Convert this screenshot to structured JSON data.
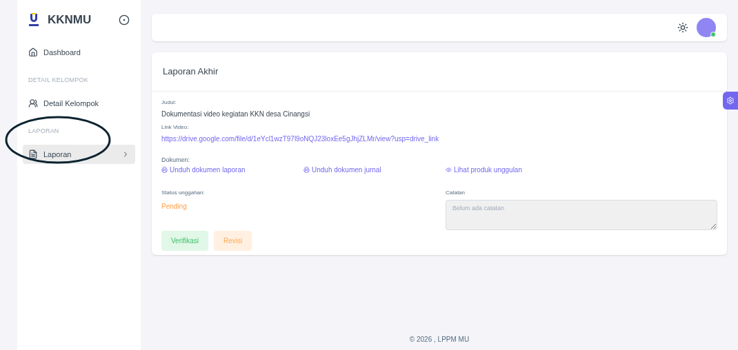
{
  "sidebar": {
    "brand": "KKNMU",
    "items": [
      {
        "kind": "link",
        "label": "Dashboard",
        "selected": false
      },
      {
        "kind": "heading",
        "label": "DETAIL KELOMPOK"
      },
      {
        "kind": "link",
        "label": "Detail Kelompok",
        "selected": false
      },
      {
        "kind": "heading",
        "label": "LAPORAN"
      },
      {
        "kind": "link",
        "label": "Laporan",
        "selected": true,
        "submenu": true
      }
    ]
  },
  "header": {
    "avatar_online": true
  },
  "card": {
    "title": "Laporan Akhir",
    "judul": {
      "label": "Judul:",
      "value": "Dokumentasi video kegiatan KKN desa Cinangsi"
    },
    "link_video": {
      "label": "Link Video:",
      "value": "https://drive.google.com/file/d/1eYcl1wzT97l9oNQJ23loxEe5gJhjZLMr/view?usp=drive_link"
    },
    "dokumen": {
      "label": "Dokumen:",
      "links": [
        {
          "label": "Unduh dokumen laporan"
        },
        {
          "label": "Unduh dokumen jurnal"
        },
        {
          "label": "Lihat produk unggulan"
        }
      ]
    },
    "status": {
      "label": "Status unggahan:",
      "value": "Pending"
    },
    "catatan": {
      "label": "Catatan",
      "placeholder": "Belum ada catatan"
    },
    "buttons": [
      {
        "label": "Verifikasi",
        "kind": "success"
      },
      {
        "label": "Revisi",
        "kind": "warning"
      }
    ]
  },
  "footer": "© 2026 , LPPM MU"
}
